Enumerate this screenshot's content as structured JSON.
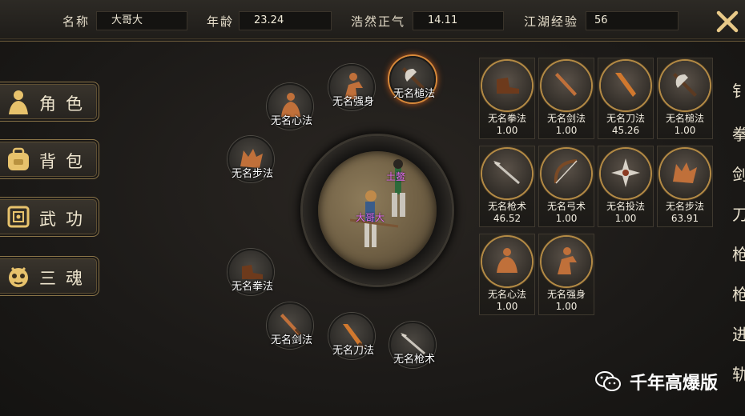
{
  "stats": {
    "name_label": "名称",
    "name_value": "大哥大",
    "age_label": "年龄",
    "age_value": "23.24",
    "righteous_label": "浩然正气",
    "righteous_value": "14.11",
    "exp_label": "江湖经验",
    "exp_value": "56"
  },
  "close_icon": "close-icon",
  "menu": [
    {
      "label": "角色",
      "icon": "character-icon"
    },
    {
      "label": "背包",
      "icon": "backpack-icon"
    },
    {
      "label": "武功",
      "icon": "scroll-icon"
    },
    {
      "label": "三魂",
      "icon": "soul-icon"
    }
  ],
  "ring_skills": [
    {
      "name": "无名心法",
      "icon": "meditation-icon"
    },
    {
      "name": "无名强身",
      "icon": "strength-icon"
    },
    {
      "name": "无名槌法",
      "icon": "axe-icon",
      "active": true
    },
    {
      "name": "无名步法",
      "icon": "wolf-icon"
    },
    {
      "name": "无名拳法",
      "icon": "boot-icon"
    },
    {
      "name": "无名剑法",
      "icon": "sword-icon"
    },
    {
      "name": "无名刀法",
      "icon": "blade-icon"
    },
    {
      "name": "无名枪术",
      "icon": "spear-icon"
    }
  ],
  "center": {
    "player_name": "大哥大",
    "npc_name": "土鳖"
  },
  "skill_panels": [
    {
      "name": "无名拳法",
      "value": "1.00",
      "icon": "boot-icon"
    },
    {
      "name": "无名剑法",
      "value": "1.00",
      "icon": "sword-icon"
    },
    {
      "name": "无名刀法",
      "value": "45.26",
      "icon": "blade-icon"
    },
    {
      "name": "无名槌法",
      "value": "1.00",
      "icon": "axe-icon"
    },
    {
      "name": "无名枪术",
      "value": "46.52",
      "icon": "spear-icon"
    },
    {
      "name": "无名弓术",
      "value": "1.00",
      "icon": "bow-icon"
    },
    {
      "name": "无名投法",
      "value": "1.00",
      "icon": "shuriken-icon"
    },
    {
      "name": "无名步法",
      "value": "63.91",
      "icon": "wolf-icon"
    },
    {
      "name": "无名心法",
      "value": "1.00",
      "icon": "meditation-icon"
    },
    {
      "name": "无名强身",
      "value": "1.00",
      "icon": "strength-icon"
    }
  ],
  "side_chars": [
    "钅",
    "拳",
    "剑",
    "刀",
    "枪",
    "枪",
    "进",
    "轨"
  ],
  "watermark": {
    "text": "千年高爆版",
    "icon": "wechat-icon"
  },
  "colors": {
    "accent": "#d88a3a",
    "gold": "#b38a45",
    "name_pink": "#e46cf2"
  }
}
